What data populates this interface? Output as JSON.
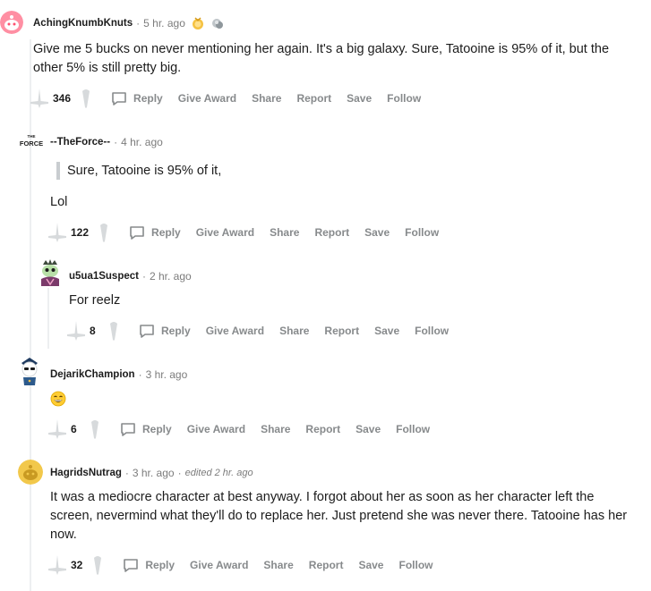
{
  "actions": {
    "reply": "Reply",
    "give_award": "Give Award",
    "share": "Share",
    "report": "Report",
    "save": "Save",
    "follow": "Follow"
  },
  "comments": [
    {
      "username": "AchingKnumbKnuts",
      "time": "5 hr. ago",
      "awards": [
        "award-icon",
        "award-icon"
      ],
      "text": "Give me 5 bucks on never mentioning her again. It's a big galaxy. Sure, Tatooine is 95% of it, but the other 5% is still pretty big.",
      "score": "346",
      "avatar_color": "#ff8fa3"
    },
    {
      "username": "--TheForce--",
      "time": "4 hr. ago",
      "avatar_text": "THE FORCE",
      "quote": "Sure, Tatooine is 95% of it,",
      "text": "Lol",
      "score": "122"
    },
    {
      "username": "u5ua1Suspect",
      "time": "2 hr. ago",
      "text": "For reelz",
      "score": "8"
    },
    {
      "username": "DejarikChampion",
      "time": "3 hr. ago",
      "text_icon": "laughing-emoji-icon",
      "score": "6"
    },
    {
      "username": "HagridsNutrag",
      "time": "3 hr. ago",
      "edited": "edited 2 hr. ago",
      "text": "It was a mediocre character at best anyway. I forgot about her as soon as her character left the screen, nevermind what they'll do to replace her. Just pretend she was never there. Tatooine has her now.",
      "score": "32",
      "avatar_color": "#f2c84b"
    }
  ],
  "colors": {
    "meta": "#7c7c7c",
    "action": "#878a8c",
    "thread_line": "#edeff1"
  }
}
